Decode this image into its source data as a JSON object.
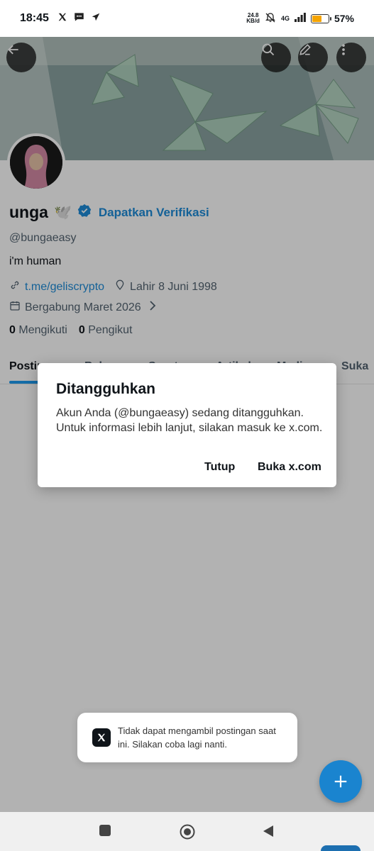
{
  "status_bar": {
    "time": "18:45",
    "net_speed_value": "24.8",
    "net_speed_unit": "KB/d",
    "network": "4G",
    "battery_percent": "57%",
    "battery_level": 0.57,
    "left_icons": [
      "x-logo-icon",
      "message-icon",
      "send-icon"
    ],
    "right_icons": [
      "mute-bell-icon",
      "signal-icon",
      "battery-icon"
    ]
  },
  "header": {
    "buttons": [
      "back-icon",
      "search-icon",
      "edit-icon",
      "more-icon"
    ]
  },
  "profile": {
    "name": "unga",
    "name_emoji": "🕊️",
    "verify_label": "Dapatkan Verifikasi",
    "handle": "@bungaeasy",
    "bio": "i'm human",
    "link": "t.me/geliscrypto",
    "birthday": "Lahir 8 Juni 1998",
    "joined": "Bergabung Maret 2026",
    "following_count": "0",
    "following_label": "Mengikuti",
    "followers_count": "0",
    "followers_label": "Pengikut"
  },
  "tabs": [
    {
      "label": "Postingan",
      "active": true
    },
    {
      "label": "Balasan",
      "active": false
    },
    {
      "label": "Sorotan",
      "active": false
    },
    {
      "label": "Artikel",
      "active": false
    },
    {
      "label": "Media",
      "active": false
    },
    {
      "label": "Suka",
      "active": false
    }
  ],
  "dialog": {
    "title": "Ditangguhkan",
    "message": "Akun Anda (@bungaeasy) sedang ditangguhkan. Untuk informasi lebih lanjut, silakan masuk ke x.com.",
    "close_label": "Tutup",
    "open_label": "Buka x.com"
  },
  "toast": {
    "message": "Tidak dapat mengambil postingan saat ini. Silakan coba lagi nanti.",
    "icon": "x-logo-icon"
  },
  "fab": {
    "icon": "plus-icon"
  },
  "colors": {
    "accent": "#1d9bf0",
    "link": "#1d8cd8",
    "fab": "#1a84cf",
    "battery": "#f5a400"
  }
}
